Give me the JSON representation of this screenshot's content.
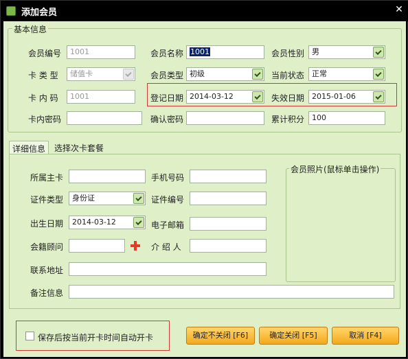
{
  "window": {
    "title": "添加会员",
    "close_label": "✕"
  },
  "basic": {
    "legend": "基本信息",
    "member_no_label": "会员编号",
    "member_no_value": "1001",
    "member_name_label": "会员名称",
    "member_name_value": "1001",
    "gender_label": "会员性别",
    "gender_value": "男",
    "card_type_label": "卡 类 型",
    "card_type_value": "储值卡",
    "member_type_label": "会员类型",
    "member_type_value": "初级",
    "status_label": "当前状态",
    "status_value": "正常",
    "card_code_label": "卡 内 码",
    "card_code_value": "1001",
    "reg_date_label": "登记日期",
    "reg_date_value": "2014-03-12",
    "expire_date_label": "失效日期",
    "expire_date_value": "2015-01-06",
    "card_pwd_label": "卡内密码",
    "card_pwd_value": "",
    "confirm_pwd_label": "确认密码",
    "confirm_pwd_value": "",
    "points_label": "累计积分",
    "points_value": "100"
  },
  "tabs": {
    "detail": "详细信息",
    "choose_card": "选择次卡套餐"
  },
  "detail": {
    "main_card_label": "所属主卡",
    "main_card_value": "",
    "phone_label": "手机号码",
    "phone_value": "",
    "id_type_label": "证件类型",
    "id_type_value": "身份证",
    "id_no_label": "证件编号",
    "id_no_value": "",
    "birth_label": "出生日期",
    "birth_value": "2014-03-12",
    "email_label": "电子邮箱",
    "email_value": "",
    "advisor_label": "会籍顾问",
    "advisor_value": "",
    "referrer_label": "介 绍 人",
    "referrer_value": "",
    "address_label": "联系地址",
    "address_value": "",
    "remark_label": "备注信息",
    "remark_value": "",
    "photo_legend": "会员照片(鼠标单击操作)"
  },
  "footer": {
    "auto_open_label": "保存后按当前开卡时间自动开卡",
    "btn_ok_stay": "确定不关闭 [F6]",
    "btn_ok_close": "确定关闭 [F5]",
    "btn_cancel": "取消 [F4]"
  }
}
